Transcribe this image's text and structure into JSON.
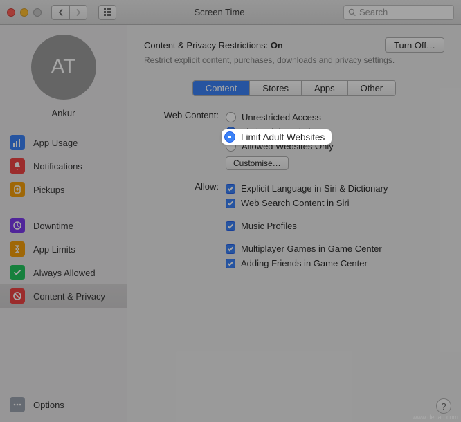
{
  "window": {
    "title": "Screen Time",
    "search_placeholder": "Search"
  },
  "sidebar": {
    "avatar_initials": "AT",
    "username": "Ankur",
    "group1": [
      {
        "icon": "appusage",
        "color": "sb-blue",
        "label": "App Usage"
      },
      {
        "icon": "bell",
        "color": "sb-red",
        "label": "Notifications"
      },
      {
        "icon": "pickups",
        "color": "sb-orange",
        "label": "Pickups"
      }
    ],
    "group2": [
      {
        "icon": "moon",
        "color": "sb-purple",
        "label": "Downtime"
      },
      {
        "icon": "hourglass",
        "color": "sb-orange",
        "label": "App Limits"
      },
      {
        "icon": "check",
        "color": "sb-green",
        "label": "Always Allowed"
      },
      {
        "icon": "block",
        "color": "sb-red",
        "label": "Content & Privacy",
        "selected": true
      }
    ],
    "options_label": "Options"
  },
  "header": {
    "label": "Content & Privacy Restrictions:",
    "state": "On",
    "desc": "Restrict explicit content, purchases, downloads and privacy settings.",
    "turnoff": "Turn Off…"
  },
  "tabs": [
    "Content",
    "Stores",
    "Apps",
    "Other"
  ],
  "active_tab": 0,
  "web_content": {
    "label": "Web Content:",
    "options": [
      "Unrestricted Access",
      "Limit Adult Websites",
      "Allowed Websites Only"
    ],
    "selected": 1,
    "customise": "Customise…"
  },
  "allow": {
    "label": "Allow:",
    "items": [
      {
        "label": "Explicit Language in Siri & Dictionary",
        "checked": true
      },
      {
        "label": "Web Search Content in Siri",
        "checked": true
      },
      {
        "label": "Music Profiles",
        "checked": true,
        "gap": true
      },
      {
        "label": "Multiplayer Games in Game Center",
        "checked": true,
        "gap": true
      },
      {
        "label": "Adding Friends in Game Center",
        "checked": true
      }
    ]
  },
  "watermark": "www.deuaq.com"
}
